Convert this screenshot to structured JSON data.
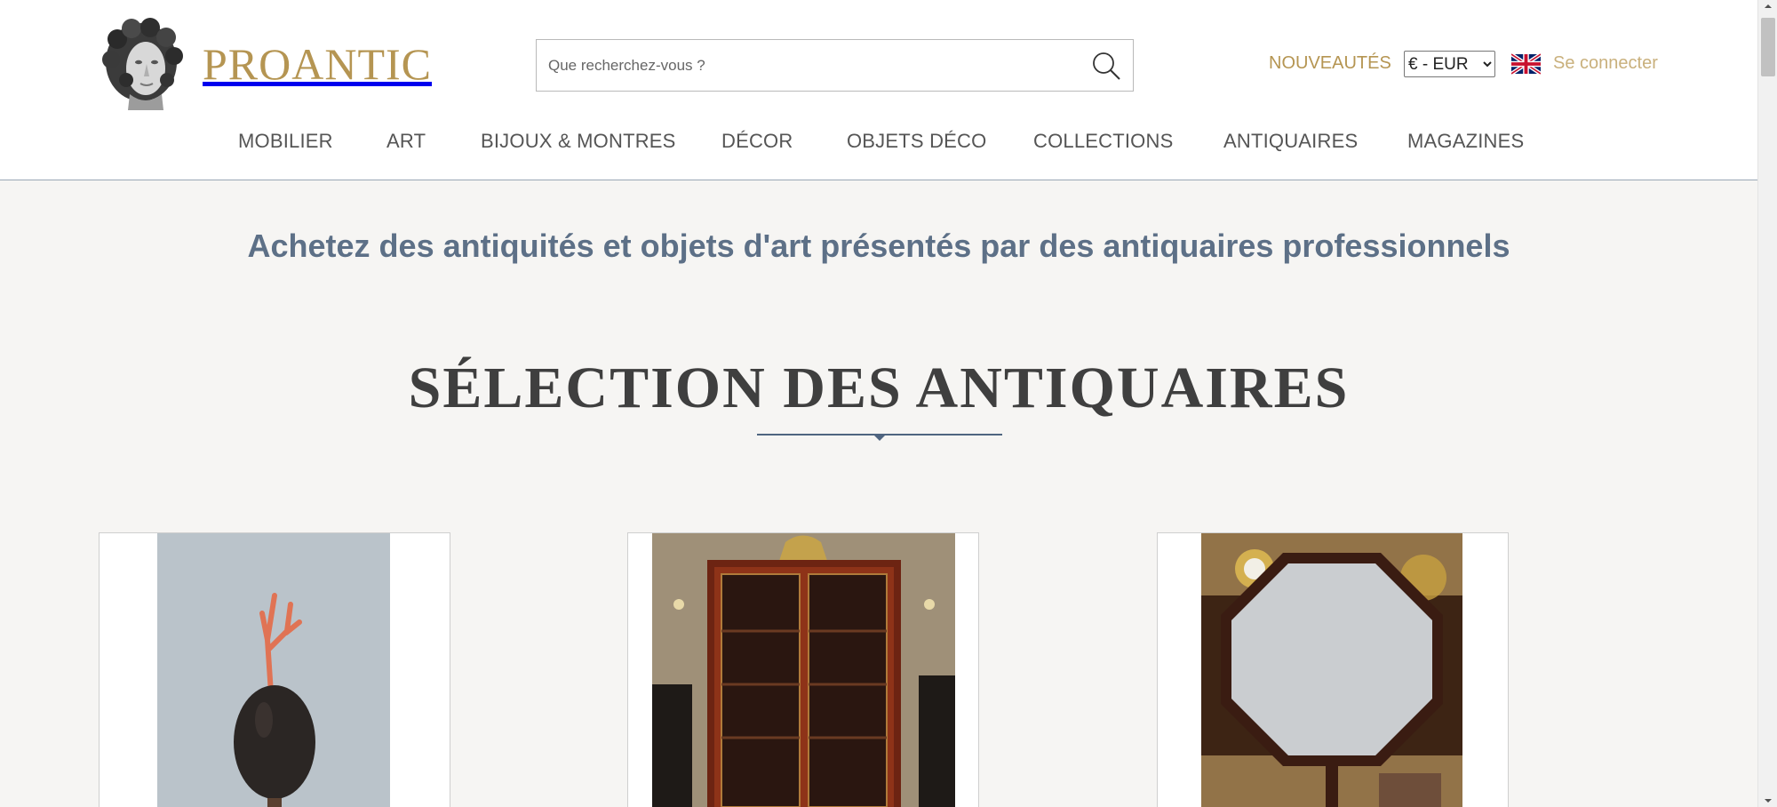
{
  "header": {
    "logo_text": "PROANTIC",
    "search": {
      "placeholder": "Que recherchez-vous ?",
      "value": ""
    },
    "nouveautes_label": "NOUVEAUTÉS",
    "currency": {
      "selected": "€ - EUR",
      "options": [
        "€ - EUR"
      ]
    },
    "login_label": "Se connecter"
  },
  "nav": {
    "items": [
      "MOBILIER",
      "ART",
      "BIJOUX & MONTRES",
      "DÉCOR",
      "OBJETS DÉCO",
      "COLLECTIONS",
      "ANTIQUAIRES",
      "MAGAZINES"
    ]
  },
  "main": {
    "tagline": "Achetez des antiquités et objets d'art présentés par des antiquaires professionnels",
    "section_title": "SÉLECTION DES ANTIQUAIRES"
  },
  "cards": [
    {
      "image": "egg-on-stand-with-coral-branch"
    },
    {
      "image": "mahogany-bookcase-cabinet"
    },
    {
      "image": "octagonal-marble-tilt-top-table"
    }
  ],
  "colors": {
    "brand_gold": "#b59552",
    "login_gold": "#c9b07c",
    "tagline_blue": "#5d7087",
    "background": "#f6f5f3"
  },
  "icons": [
    "logo-bust-icon",
    "search-icon",
    "uk-flag-icon",
    "chevron-down-icon"
  ]
}
